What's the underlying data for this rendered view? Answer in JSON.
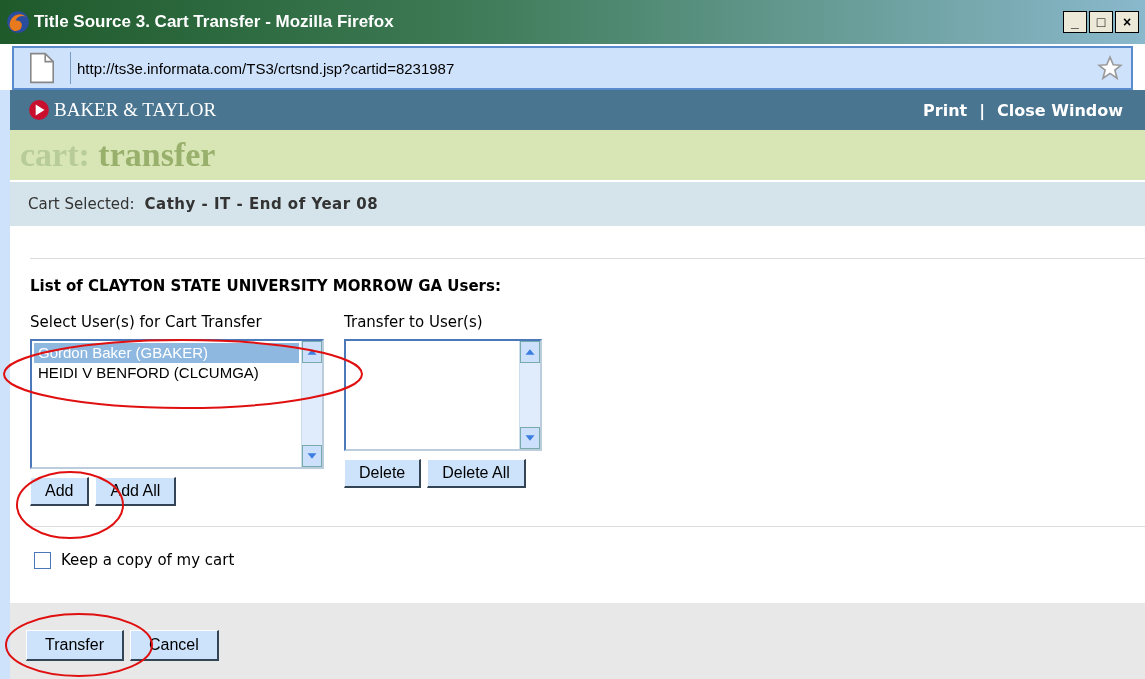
{
  "window": {
    "title": "Title Source 3. Cart Transfer - Mozilla Firefox",
    "controls": [
      "_",
      "□",
      "×"
    ]
  },
  "address_bar": {
    "url": "http://ts3e.informata.com/TS3/crtsnd.jsp?cartid=8231987"
  },
  "header": {
    "brand": "BAKER & TAYLOR",
    "links": [
      "Print",
      "Close Window"
    ],
    "separator": "|"
  },
  "page_title": {
    "prefix": "cart:",
    "word": "transfer"
  },
  "cart_selected": {
    "label": "Cart Selected:",
    "value": "Cathy - IT - End of Year 08"
  },
  "list_heading": "List of CLAYTON STATE UNIVERSITY MORROW GA Users:",
  "source_list": {
    "label": "Select User(s) for Cart Transfer",
    "items": [
      {
        "text": "Gordon Baker (GBAKER)",
        "selected": true
      },
      {
        "text": "HEIDI V BENFORD (CLCUMGA)",
        "selected": false
      }
    ],
    "buttons": [
      "Add",
      "Add All"
    ]
  },
  "target_list": {
    "label": "Transfer to User(s)",
    "buttons": [
      "Delete",
      "Delete All"
    ]
  },
  "keep_copy": {
    "label": "Keep a copy of my cart",
    "checked": false
  },
  "footer_buttons": [
    "Transfer",
    "Cancel"
  ]
}
